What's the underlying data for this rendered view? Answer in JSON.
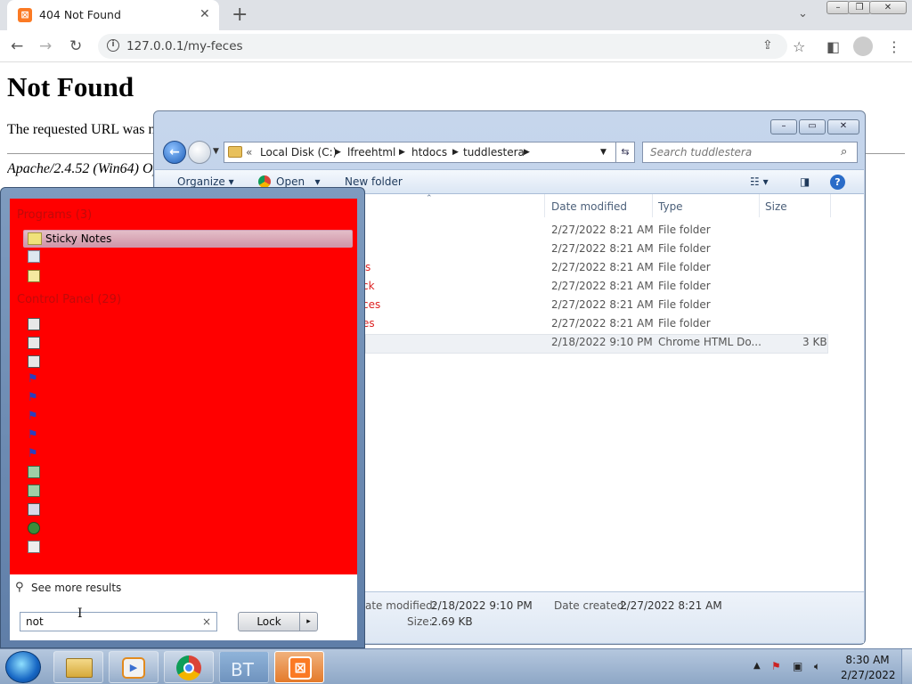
{
  "browser": {
    "tab_title": "404 Not Found",
    "tab_favicon": "xampp-icon",
    "new_tab": "+",
    "url": "127.0.0.1/my-feces",
    "window_controls": [
      "minimize-icon",
      "restore-icon",
      "close-icon"
    ]
  },
  "page": {
    "heading": "Not Found",
    "paragraph": "The requested URL was not found on this server.",
    "address": "Apache/2.4.52 (Win64) OpenSSL/1.1.1m PHP/8.1.2 Server at 127.0.0.1 Port 80"
  },
  "explorer": {
    "breadcrumb_prefix": "«",
    "breadcrumbs": [
      "Local Disk (C:)",
      "lfreehtml",
      "htdocs",
      "tuddlestera"
    ],
    "search_placeholder": "Search tuddlestera",
    "commands": {
      "organize": "Organize",
      "open": "Open",
      "new_folder": "New folder"
    },
    "columns": {
      "date": "Date modified",
      "type": "Type",
      "size": "Size"
    },
    "rows": [
      {
        "name": "",
        "date": "2/27/2022 8:21 AM",
        "type": "File folder",
        "size": ""
      },
      {
        "name": "",
        "date": "2/27/2022 8:21 AM",
        "type": "File folder",
        "size": ""
      },
      {
        "name": "s",
        "date": "2/27/2022 8:21 AM",
        "type": "File folder",
        "size": ""
      },
      {
        "name": "ck",
        "date": "2/27/2022 8:21 AM",
        "type": "File folder",
        "size": ""
      },
      {
        "name": "ces",
        "date": "2/27/2022 8:21 AM",
        "type": "File folder",
        "size": ""
      },
      {
        "name": "es",
        "date": "2/27/2022 8:21 AM",
        "type": "File folder",
        "size": ""
      },
      {
        "name": "",
        "date": "2/18/2022 9:10 PM",
        "type": "Chrome HTML Do...",
        "size": "3 KB"
      }
    ],
    "details": {
      "modified_label": "ate modified:",
      "modified_value": "2/18/2022 9:10 PM",
      "created_label": "Date created:",
      "created_value": "2/27/2022 8:21 AM",
      "size_label": "Size:",
      "size_value": "2.69 KB"
    }
  },
  "start_menu": {
    "programs_header": "Programs (3)",
    "selected_program": "Sticky Notes",
    "control_panel_header": "Control Panel (29)",
    "see_more": "See more results",
    "search_value": "not",
    "clear": "×",
    "lock_label": "Lock"
  },
  "taskbar": {
    "time": "8:30 AM",
    "date": "2/27/2022",
    "pinned": [
      "explorer-icon",
      "media-player-icon",
      "chrome-icon",
      "bt-icon",
      "xampp-icon"
    ],
    "bt_label": "BT"
  }
}
